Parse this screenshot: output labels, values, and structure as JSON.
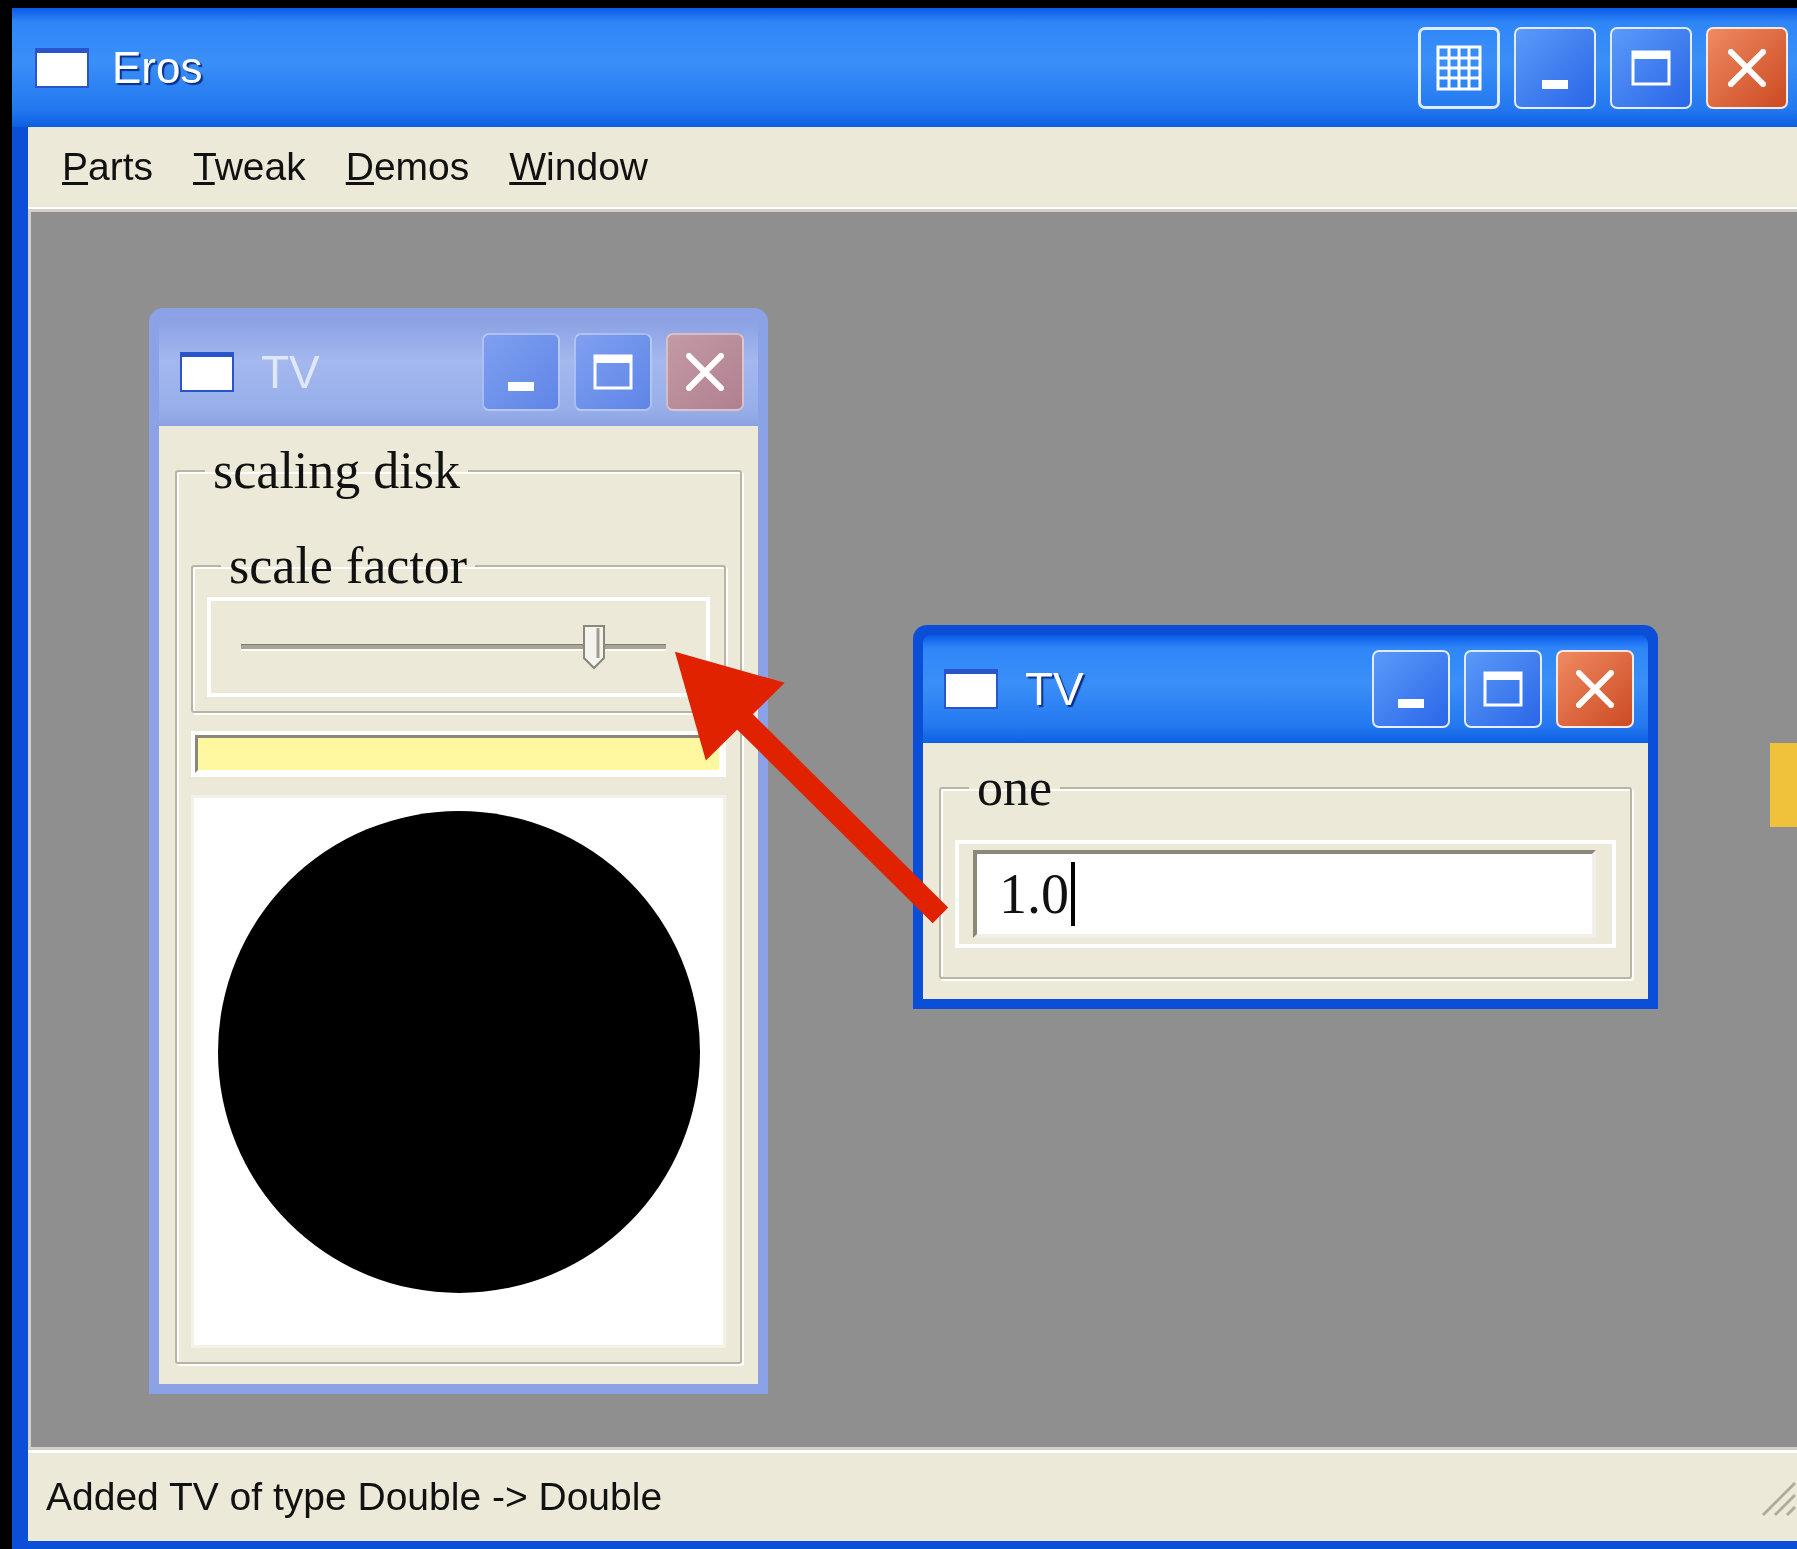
{
  "window": {
    "title": "Eros",
    "active": true,
    "buttons": [
      {
        "kind": "tile"
      },
      {
        "kind": "minimize"
      },
      {
        "kind": "maximize"
      },
      {
        "kind": "close"
      }
    ]
  },
  "menu": [
    {
      "label": "Parts"
    },
    {
      "label": "Tweak"
    },
    {
      "label": "Demos"
    },
    {
      "label": "Window"
    }
  ],
  "desktop": {
    "windows": [
      {
        "title": "TV",
        "active": false,
        "kind": "scaler",
        "buttons": [
          {
            "kind": "minimize"
          },
          {
            "kind": "maximize"
          },
          {
            "kind": "close"
          }
        ],
        "group_label": "scaling disk",
        "slider_label": "scale factor",
        "slider": {
          "level": 0.83
        }
      },
      {
        "title": "TV",
        "active": true,
        "kind": "input",
        "buttons": [
          {
            "kind": "minimize"
          },
          {
            "kind": "maximize"
          },
          {
            "kind": "close"
          }
        ],
        "group_label": "one",
        "field": {
          "value": "1.0",
          "focused": true
        }
      }
    ],
    "annotations": [
      {
        "kind": "arrow"
      }
    ]
  },
  "status_bar": {
    "text": "Added TV of type Double -> Double"
  }
}
